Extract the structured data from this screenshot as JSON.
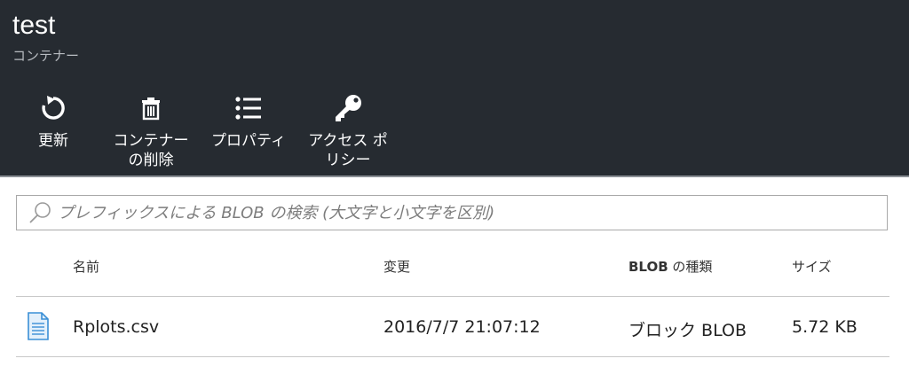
{
  "header": {
    "title": "test",
    "subtitle": "コンテナー"
  },
  "toolbar": [
    {
      "label": "更新",
      "icon": "refresh-icon"
    },
    {
      "label": "コンテナーの削除",
      "icon": "trash-icon"
    },
    {
      "label": "プロパティ",
      "icon": "list-icon"
    },
    {
      "label": "アクセス ポリシー",
      "icon": "key-icon"
    }
  ],
  "search": {
    "placeholder": "プレフィックスによる BLOB の検索 (大文字と小文字を区別)",
    "value": ""
  },
  "table": {
    "columns": {
      "name": "名前",
      "modified": "変更",
      "type_bold": "BLOB",
      "type_rest": " の種類",
      "size": "サイズ"
    },
    "rows": [
      {
        "name": "Rplots.csv",
        "modified": "2016/7/7 21:07:12",
        "type": "ブロック BLOB",
        "size": "5.72 KB",
        "icon": "document-icon"
      }
    ]
  },
  "colors": {
    "header_bg": "#262b31",
    "header_text": "#ffffff",
    "file_icon": "#3a8fd6"
  }
}
